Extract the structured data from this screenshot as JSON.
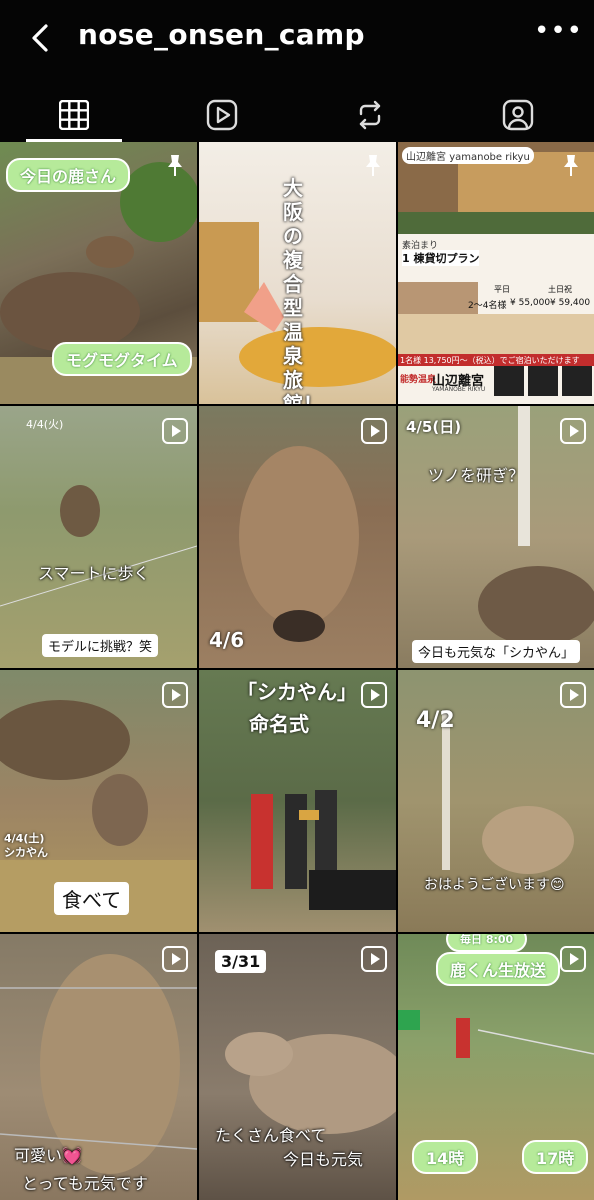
{
  "header": {
    "username": "nose_onsen_camp",
    "more_label": "•••"
  },
  "tabs": [
    {
      "name": "grid",
      "icon": "grid-icon"
    },
    {
      "name": "reels",
      "icon": "reels-icon"
    },
    {
      "name": "reposts",
      "icon": "repost-icon"
    },
    {
      "name": "tagged",
      "icon": "tagged-icon"
    }
  ],
  "posts": {
    "p1": {
      "tag": "今日の鹿さん",
      "caption": "モグモグタイム"
    },
    "p2": {
      "title": "大阪の複合型温泉旅館！"
    },
    "p3": {
      "logo": "山辺離宮",
      "logo_sub": "yamanobe rikyu",
      "plan_label": "素泊まり",
      "plan_title": "1 棟貸切プラン",
      "tag_onsen": "能勢温泉",
      "price_a": "平日",
      "price_b": "土日祝",
      "guests": "2〜4名様",
      "price_weekday": "¥ 55,000",
      "price_weekend": "¥ 59,400",
      "price_note": "1名様 13,750円〜（税込）でご宿泊いただけます",
      "brand": "山辺離宮",
      "brand_sub": "YAMANOBE RIKYU"
    },
    "p4": {
      "date": "4/4(火)",
      "caption1": "スマートに歩く",
      "caption2": "モデルに挑戦？笑"
    },
    "p5": {
      "date": "4/6"
    },
    "p6": {
      "date": "4/5(日)",
      "caption1": "ツノを研ぎ？",
      "caption2": "今日も元気な「シカやん」"
    },
    "p7": {
      "date": "4/4(土)",
      "name": "シカやん",
      "caption": "食べて"
    },
    "p8": {
      "title1": "「シカやん」",
      "title2": "命名式"
    },
    "p9": {
      "date": "4/2",
      "caption": "おはようございます😊"
    },
    "p10": {
      "caption1": "可愛い💓",
      "caption2": "とっても元気です"
    },
    "p11": {
      "date": "3/31",
      "caption1": "たくさん食べて",
      "caption2": "今日も元気"
    },
    "p12": {
      "top": "毎日 8:00",
      "title": "鹿くん生放送",
      "time1": "14時",
      "time2": "17時"
    }
  },
  "colors": {
    "green_pill": "#b6ea9a",
    "header_bg": "#050505"
  }
}
